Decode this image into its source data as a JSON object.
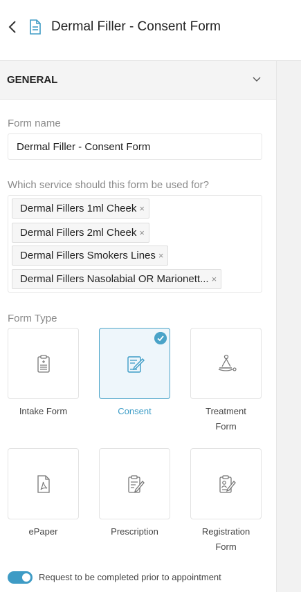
{
  "header": {
    "title": "Dermal Filler - Consent Form"
  },
  "section": {
    "title": "GENERAL"
  },
  "form_name": {
    "label": "Form name",
    "value": "Dermal Filler - Consent Form"
  },
  "services": {
    "label": "Which service should this form be used for?",
    "tags": [
      "Dermal Fillers 1ml Cheek",
      "Dermal Fillers 2ml Cheek",
      "Dermal Fillers Smokers Lines",
      "Dermal Fillers Nasolabial OR Marionett..."
    ],
    "remove_glyph": "×"
  },
  "form_type": {
    "label": "Form Type",
    "options": [
      {
        "line1": "Intake Form",
        "line2": "",
        "icon": "clipboard-icon",
        "selected": false
      },
      {
        "line1": "Consent",
        "line2": "",
        "icon": "pen-on-paper-icon",
        "selected": true
      },
      {
        "line1": "Treatment",
        "line2": "Form",
        "icon": "treatment-table-icon",
        "selected": false
      },
      {
        "line1": "ePaper",
        "line2": "",
        "icon": "pdf-file-icon",
        "selected": false
      },
      {
        "line1": "Prescription",
        "line2": "",
        "icon": "prescription-pad-icon",
        "selected": false
      },
      {
        "line1": "Registration",
        "line2": "Form",
        "icon": "registration-clipboard-icon",
        "selected": false
      }
    ]
  },
  "toggle": {
    "label": "Request to be completed prior to appointment",
    "on": true
  },
  "colors": {
    "accent": "#3e9bc5",
    "selected_bg": "#eef6fb"
  }
}
